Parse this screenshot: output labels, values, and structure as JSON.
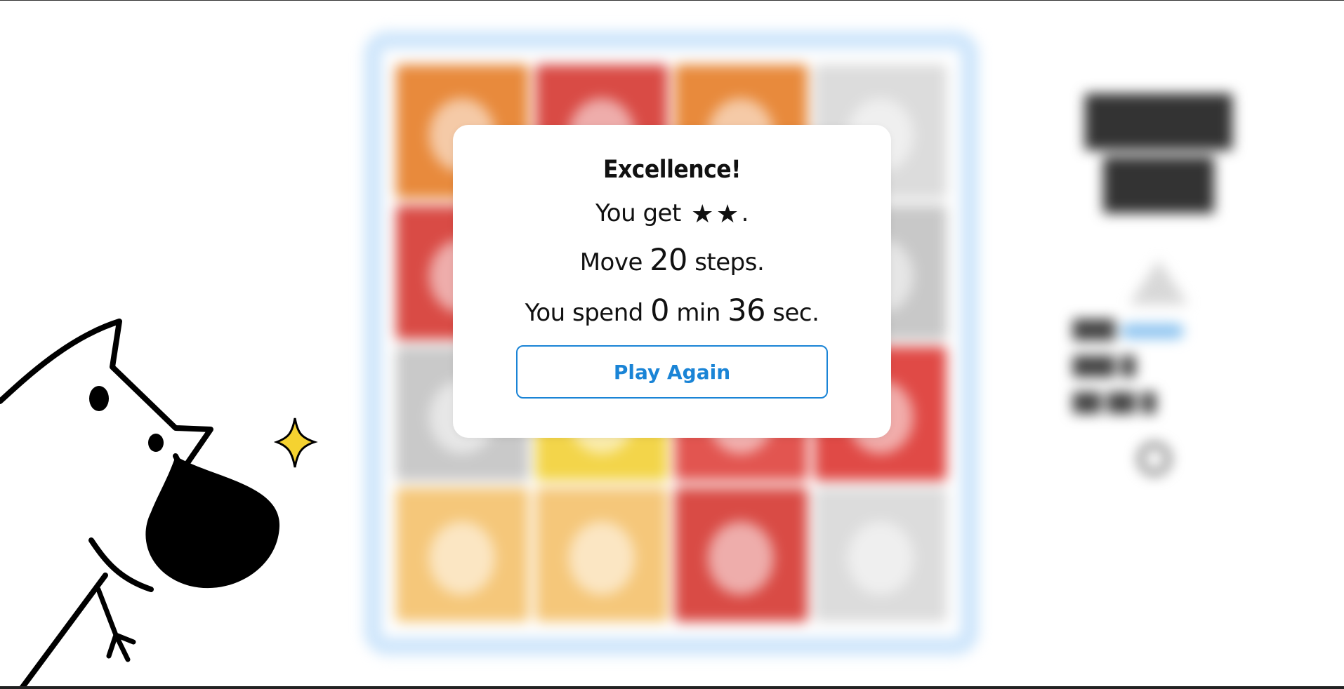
{
  "modal": {
    "title": "Excellence!",
    "rating_prefix": "You get",
    "rating_stars": 2,
    "rating_suffix": ".",
    "moves_prefix": "Move",
    "moves": "20",
    "moves_suffix": "steps.",
    "time_prefix": "You spend",
    "minutes": "0",
    "min_label": "min",
    "seconds": "36",
    "sec_label": "sec.",
    "play_again_label": "Play Again"
  },
  "colors": {
    "accent": "#1a84d6",
    "board_border": "#cfe6fb",
    "star": "#111111",
    "sparkle": "#f5d230"
  },
  "board": {
    "cards": [
      {
        "color": "#e88a3c",
        "icon": "fox-card"
      },
      {
        "color": "#d94b45",
        "icon": "cat-card"
      },
      {
        "color": "#e88a3c",
        "icon": "fox-card"
      },
      {
        "color": "#dcdcdc",
        "icon": "raccoon-card"
      },
      {
        "color": "#d94b45",
        "icon": "cat-card"
      },
      {
        "color": "#f0e2c8",
        "icon": "dog-card"
      },
      {
        "color": "#f0e2c8",
        "icon": "dog-card"
      },
      {
        "color": "#c8c8c8",
        "icon": "badger-card"
      },
      {
        "color": "#c9c9c9",
        "icon": "owl-card"
      },
      {
        "color": "#f3d54a",
        "icon": "chick-card"
      },
      {
        "color": "#e25550",
        "icon": "rabbit-card"
      },
      {
        "color": "#e04a46",
        "icon": "frog-card"
      },
      {
        "color": "#f5c77a",
        "icon": "bear-card"
      },
      {
        "color": "#f5c77a",
        "icon": "bear-card"
      },
      {
        "color": "#d94b45",
        "icon": "cat-card"
      },
      {
        "color": "#dcdcdc",
        "icon": "raccoon-card"
      }
    ]
  }
}
